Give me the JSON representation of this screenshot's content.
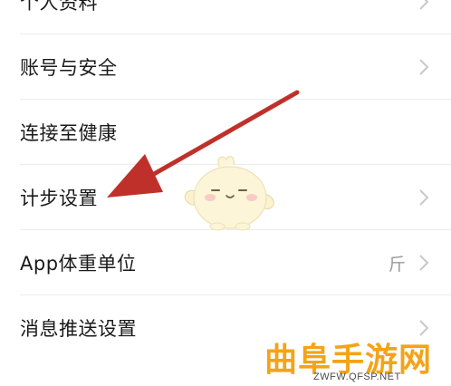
{
  "settings": {
    "items": [
      {
        "label": "个人资料",
        "value": ""
      },
      {
        "label": "账号与安全",
        "value": ""
      },
      {
        "label": "连接至健康",
        "value": ""
      },
      {
        "label": "计步设置",
        "value": ""
      },
      {
        "label": "App体重单位",
        "value": "斤"
      },
      {
        "label": "消息推送设置",
        "value": ""
      }
    ]
  },
  "icons": {
    "chevron": "chevron-right-icon",
    "arrow": "red-arrow-annotation",
    "mascot": "mascot-character"
  },
  "colors": {
    "arrow": "#c0302a",
    "watermark": "#f4a318",
    "chevron": "#c8c8c8",
    "divider": "#ececec"
  },
  "watermark": {
    "logo_text": "曲阜手游网",
    "url": "ZWFW.QFSP.NET"
  }
}
